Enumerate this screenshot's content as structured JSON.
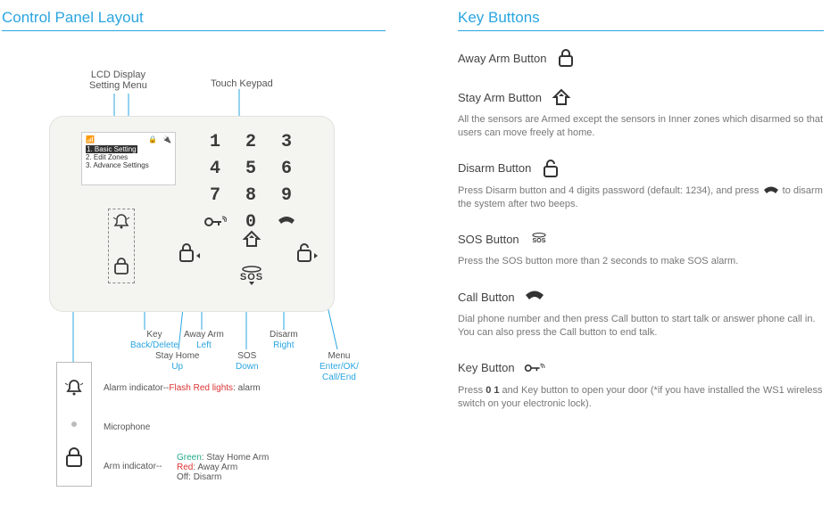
{
  "left_title": "Control Panel Layout",
  "right_title": "Key Buttons",
  "callouts": {
    "lcd_line1": "LCD Display",
    "lcd_line2": "Setting Menu",
    "keypad": "Touch Keypad"
  },
  "lcd_menu": {
    "line1": "1. Basic Setting",
    "line2": "2. Edit Zones",
    "line3": "3. Advance Settings"
  },
  "keypad_digits": [
    "1",
    "2",
    "3",
    "4",
    "5",
    "6",
    "7",
    "8",
    "9",
    "",
    "0",
    ""
  ],
  "sos_label": "SOS",
  "bottom_callouts": {
    "key": {
      "t": "Key",
      "b": "Back/Delete"
    },
    "away": {
      "t": "Away Arm",
      "b": "Left"
    },
    "stay": {
      "t": "Stay Home",
      "b": "Up"
    },
    "sos": {
      "t": "SOS",
      "b": "Down"
    },
    "disarm": {
      "t": "Disarm",
      "b": "Right"
    },
    "menu": {
      "t": "Menu",
      "b": "Enter/OK/",
      "c": "Call/End"
    }
  },
  "legend": {
    "alarm_label": "Alarm indicator--",
    "alarm_red": "Flash Red lights",
    "alarm_suffix": ": alarm",
    "mic": "Microphone",
    "arm_label": "Arm indicator--",
    "green_t": "Green",
    "green_v": ": Stay Home Arm",
    "red_t": "Red",
    "red_v": ": Away Arm",
    "off_t": "Off: Disarm"
  },
  "key_buttons": [
    {
      "name": "away-arm",
      "label": "Away Arm Button",
      "icon": "lock-closed",
      "desc": ""
    },
    {
      "name": "stay-arm",
      "label": "Stay Arm Button",
      "icon": "home-up",
      "desc": "All the sensors are Armed except the sensors in Inner zones which disarmed so that users can move freely at home."
    },
    {
      "name": "disarm",
      "label": "Disarm Button",
      "icon": "lock-open",
      "desc_pre": "Press Disarm button and 4 digits password (default: 1234), and press ",
      "desc_post": " to disarm the system after two beeps."
    },
    {
      "name": "sos",
      "label": "SOS Button",
      "icon": "sos",
      "desc": "Press the SOS button more than 2 seconds to make SOS alarm."
    },
    {
      "name": "call",
      "label": "Call Button",
      "icon": "phone",
      "desc": "Dial phone number and then press Call button to start talk or answer phone call in. You can also press the Call button to end talk."
    },
    {
      "name": "key",
      "label": "Key Button",
      "icon": "key",
      "desc_pre": "Press",
      "desc_code": "0 1",
      "desc_post": "and Key button to open your door (*if you have installed the WS1 wireless switch on your electronic lock)."
    }
  ]
}
